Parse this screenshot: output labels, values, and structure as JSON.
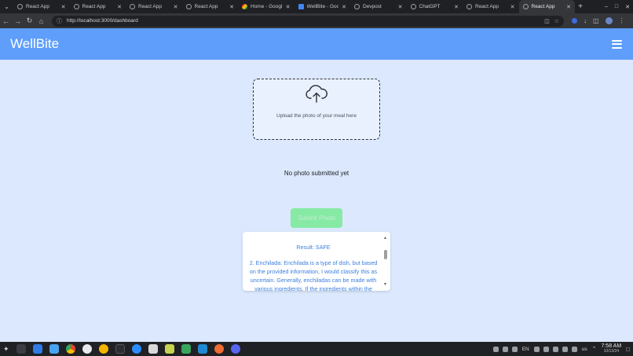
{
  "browser": {
    "tabs": [
      {
        "label": "React App",
        "icon": "globe-icon",
        "active": false
      },
      {
        "label": "React App",
        "icon": "globe-icon",
        "active": false
      },
      {
        "label": "React App",
        "icon": "globe-icon",
        "active": false
      },
      {
        "label": "React App",
        "icon": "globe-icon",
        "active": false
      },
      {
        "label": "Home - Googl",
        "icon": "google-drive-icon",
        "active": false
      },
      {
        "label": "WellBite - Goog",
        "icon": "google-docs-icon",
        "active": false
      },
      {
        "label": "Devpost",
        "icon": "devpost-icon",
        "active": false
      },
      {
        "label": "ChatGPT",
        "icon": "chatgpt-icon",
        "active": false
      },
      {
        "label": "React App",
        "icon": "globe-icon",
        "active": false
      },
      {
        "label": "React App",
        "icon": "globe-icon",
        "active": true
      }
    ],
    "url": "http://localhost:3000/dashboard"
  },
  "app": {
    "brand": "WellBite",
    "upload_text": "Upload the photo of your meal here",
    "no_photo_text": "No photo submitted yet",
    "submit_label": "Submit Photo",
    "result_title": "Result: SAFE",
    "result_body": "2. Enchilada: Enchilada is a type of dish, but based on the provided information, I would classify this as uncertain. Generally, enchiladas can be made with various ingredients. If the ingredients within the"
  },
  "taskbar": {
    "lang": "EN",
    "kb_layout": "us",
    "time": "7:58 AM",
    "date": "10/13/24"
  },
  "colors": {
    "header": "#5f9efb",
    "page_bg": "#dbe8fd",
    "submit_bg": "#86eaa4",
    "result_text": "#3b7fe0"
  }
}
